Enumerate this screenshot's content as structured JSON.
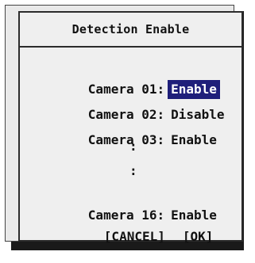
{
  "dialog": {
    "title": "Detection Enable",
    "cameras": [
      {
        "label": "Camera 01:",
        "value": "Enable",
        "selected": true
      },
      {
        "label": "Camera 02:",
        "value": "Disable",
        "selected": false
      },
      {
        "label": "Camera 03:",
        "value": "Enable",
        "selected": false
      },
      {
        "label": "Camera 16:",
        "value": "Enable",
        "selected": false
      }
    ],
    "ellipsis_marks": [
      ":",
      ":"
    ],
    "cancel_label": "[CANCEL]",
    "ok_label": "[OK]"
  },
  "colors": {
    "selection_bg": "#1f1f7a",
    "selection_fg": "#ffffff",
    "panel_bg": "#efefef",
    "border": "#2b2b2b"
  }
}
